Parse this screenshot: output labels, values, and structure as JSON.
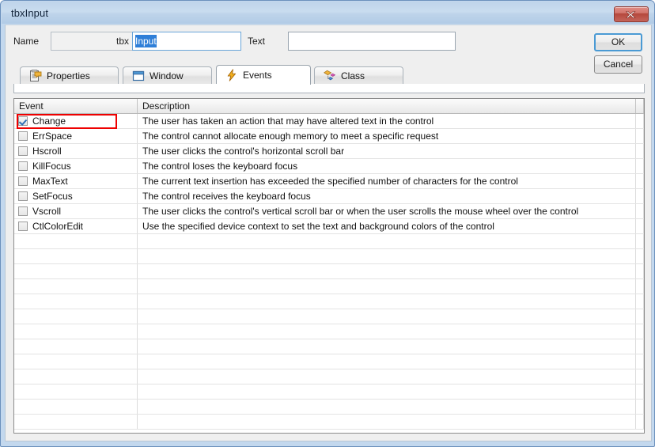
{
  "window": {
    "title": "tbxInput",
    "close_icon": "close-x-icon"
  },
  "form": {
    "name_label": "Name",
    "name_prefix_value": "tbx",
    "name_value": "Input",
    "text_label": "Text",
    "text_value": ""
  },
  "buttons": {
    "ok": "OK",
    "cancel": "Cancel"
  },
  "tabs": [
    {
      "label": "Properties",
      "icon": "properties-clipboard-icon",
      "active": false
    },
    {
      "label": "Window",
      "icon": "window-frame-icon",
      "active": false
    },
    {
      "label": "Events",
      "icon": "lightning-bolt-icon",
      "active": true
    },
    {
      "label": "Class",
      "icon": "class-diamonds-icon",
      "active": false
    }
  ],
  "grid": {
    "columns": [
      "Event",
      "Description",
      ""
    ],
    "rows": [
      {
        "checked": true,
        "event": "Change",
        "description": "The user has taken an action that may have altered text in the control",
        "highlighted": true
      },
      {
        "checked": false,
        "event": "ErrSpace",
        "description": "The control cannot allocate enough memory to meet a specific request",
        "highlighted": false
      },
      {
        "checked": false,
        "event": "Hscroll",
        "description": "The user clicks the control's horizontal scroll bar",
        "highlighted": false
      },
      {
        "checked": false,
        "event": "KillFocus",
        "description": "The control loses the keyboard focus",
        "highlighted": false
      },
      {
        "checked": false,
        "event": "MaxText",
        "description": "The current text insertion has exceeded the specified number of characters for the control",
        "highlighted": false
      },
      {
        "checked": false,
        "event": "SetFocus",
        "description": "The control receives the keyboard focus",
        "highlighted": false
      },
      {
        "checked": false,
        "event": "Vscroll",
        "description": "The user clicks the control's vertical scroll bar or when the user scrolls the mouse wheel over the control",
        "highlighted": false
      },
      {
        "checked": false,
        "event": "CtlColorEdit",
        "description": "Use the specified device context to set the text and background colors of the control",
        "highlighted": false
      }
    ],
    "empty_row_count": 13
  },
  "colors": {
    "titlebar": "#c3d8ee",
    "dialog_bg": "#efefef",
    "highlight_red": "#ee0000",
    "selection_blue": "#2f7fd8",
    "focus_blue": "#4a9ad4",
    "close_red": "#b5473c"
  }
}
